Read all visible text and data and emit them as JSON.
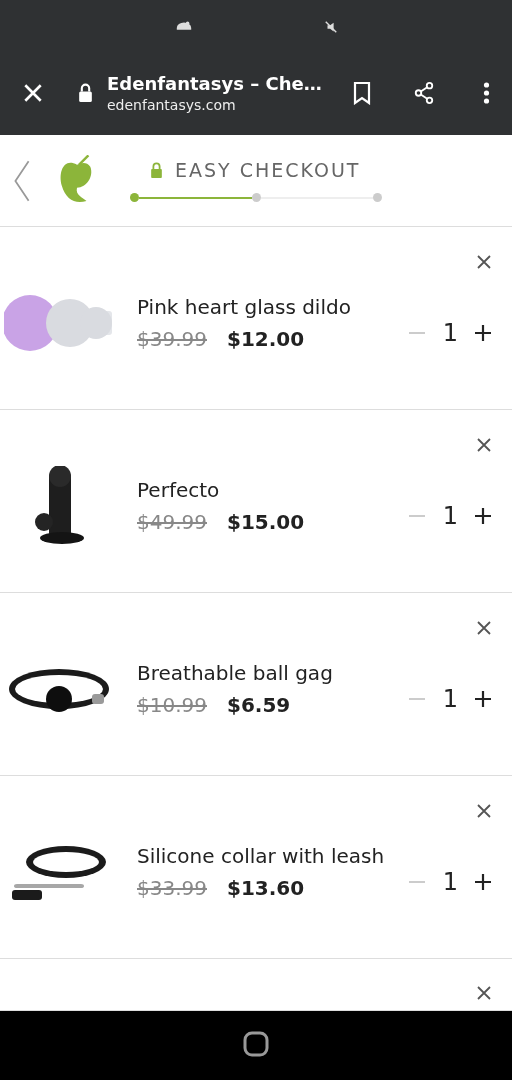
{
  "browser": {
    "title": "Edenfantasys – Che…",
    "url": "edenfantasys.com"
  },
  "checkout": {
    "title": "EASY CHECKOUT",
    "steps": [
      {
        "selected": true
      },
      {
        "selected": false
      },
      {
        "selected": false
      }
    ]
  },
  "cart_items": [
    {
      "name": "Pink heart glass dildo",
      "old_price": "$39.99",
      "price": "$12.00",
      "quantity": "1",
      "decrease_disabled": true
    },
    {
      "name": "Perfecto",
      "old_price": "$49.99",
      "price": "$15.00",
      "quantity": "1",
      "decrease_disabled": true
    },
    {
      "name": "Breathable ball gag",
      "old_price": "$10.99",
      "price": "$6.59",
      "quantity": "1",
      "decrease_disabled": true
    },
    {
      "name": "Silicone collar with leash",
      "old_price": "$33.99",
      "price": "$13.60",
      "quantity": "1",
      "decrease_disabled": true
    }
  ]
}
